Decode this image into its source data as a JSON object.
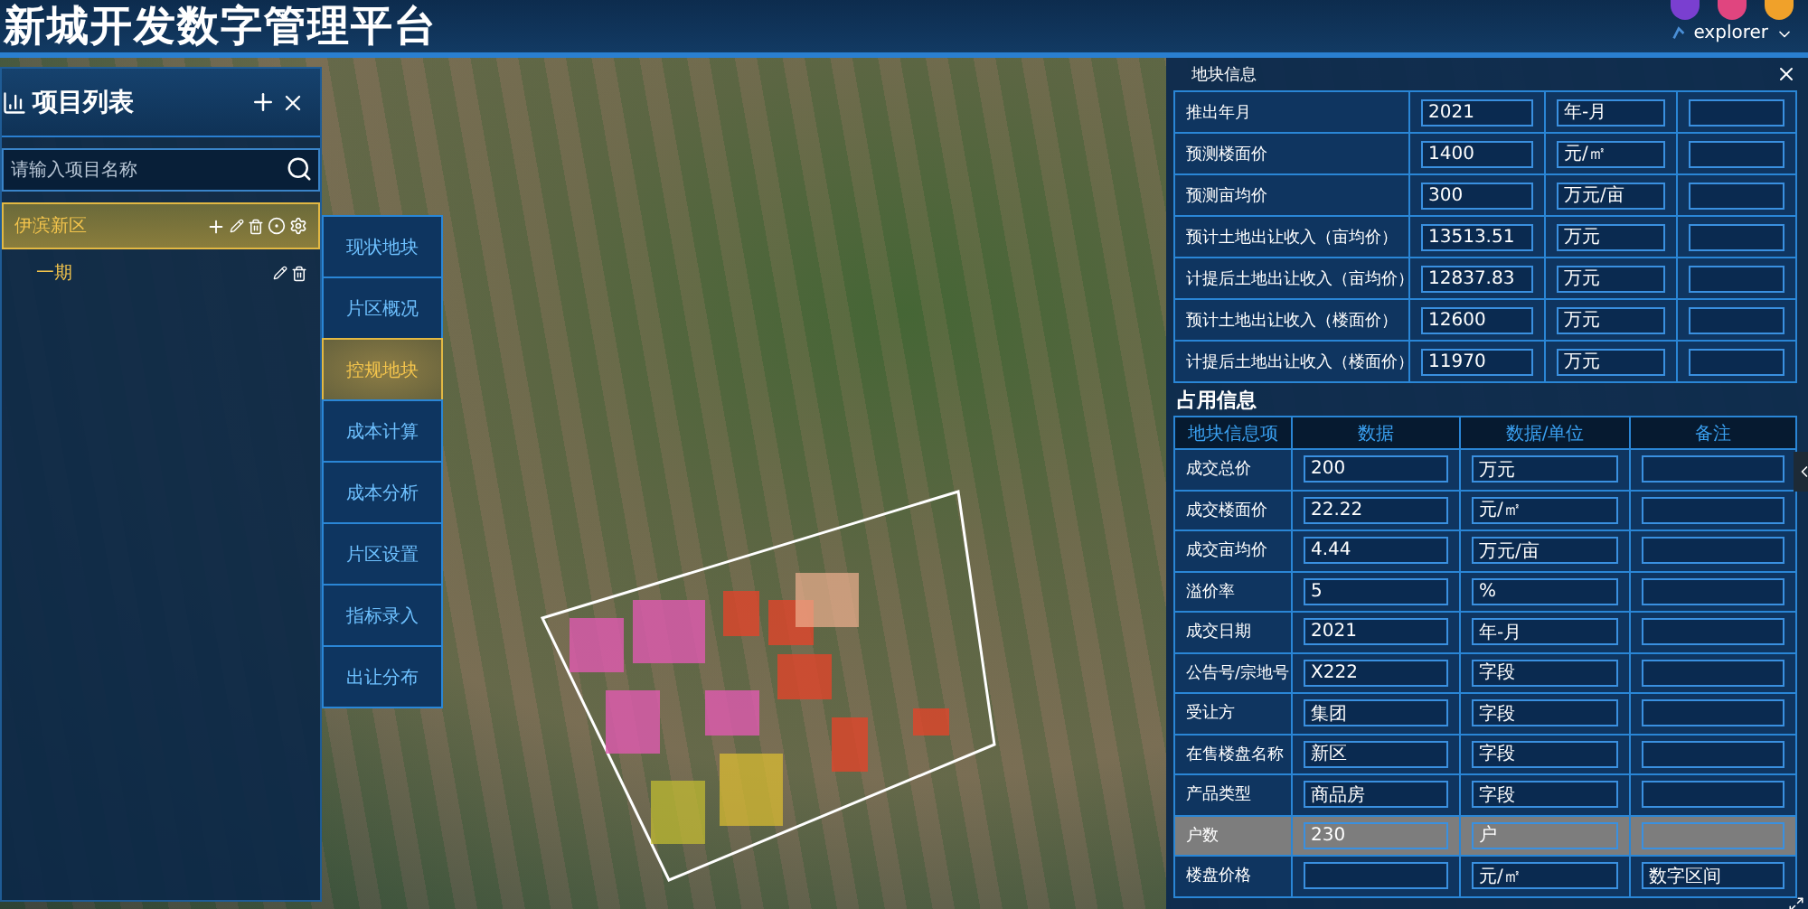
{
  "header": {
    "title": "新城开发数字管理平台",
    "user": "explorer"
  },
  "project_panel": {
    "title": "项目列表",
    "search": {
      "placeholder": "请输入项目名称"
    },
    "tree": [
      {
        "label": "伊滨新区",
        "selected": true,
        "children": [
          {
            "label": "一期",
            "selected": false
          }
        ]
      }
    ]
  },
  "side_tabs": [
    {
      "label": "现状地块",
      "selected": false
    },
    {
      "label": "片区概况",
      "selected": false
    },
    {
      "label": "控规地块",
      "selected": true
    },
    {
      "label": "成本计算",
      "selected": false
    },
    {
      "label": "成本分析",
      "selected": false
    },
    {
      "label": "片区设置",
      "selected": false
    },
    {
      "label": "指标录入",
      "selected": false
    },
    {
      "label": "出让分布",
      "selected": false
    }
  ],
  "parcel_panel": {
    "title": "地块信息",
    "rows": [
      {
        "label": "推出年月",
        "value": "2021",
        "unit": "年-月"
      },
      {
        "label": "预测楼面价",
        "value": "1400",
        "unit": "元/㎡"
      },
      {
        "label": "预测亩均价",
        "value": "300",
        "unit": "万元/亩"
      },
      {
        "label": "预计土地出让收入（亩均价）",
        "value": "13513.51",
        "unit": "万元"
      },
      {
        "label": "计提后土地出让收入（亩均价）",
        "value": "12837.83",
        "unit": "万元"
      },
      {
        "label": "预计土地出让收入（楼面价）",
        "value": "12600",
        "unit": "万元"
      },
      {
        "label": "计提后土地出让收入（楼面价）",
        "value": "11970",
        "unit": "万元"
      }
    ],
    "occupancy": {
      "title": "占用信息",
      "columns": [
        "地块信息项",
        "数据",
        "数据/单位",
        "备注"
      ],
      "rows": [
        {
          "label": "成交总价",
          "value": "200",
          "unit": "万元",
          "note": "",
          "selected": false
        },
        {
          "label": "成交楼面价",
          "value": "22.22",
          "unit": "元/㎡",
          "note": "",
          "selected": false
        },
        {
          "label": "成交亩均价",
          "value": "4.44",
          "unit": "万元/亩",
          "note": "",
          "selected": false
        },
        {
          "label": "溢价率",
          "value": "5",
          "unit": "%",
          "note": "",
          "selected": false
        },
        {
          "label": "成交日期",
          "value": "2021",
          "unit": "年-月",
          "note": "",
          "selected": false
        },
        {
          "label": "公告号/宗地号",
          "value": "X222",
          "unit": "字段",
          "note": "",
          "selected": false
        },
        {
          "label": "受让方",
          "value": "集团",
          "unit": "字段",
          "note": "",
          "selected": false
        },
        {
          "label": "在售楼盘名称",
          "value": "新区",
          "unit": "字段",
          "note": "",
          "selected": false
        },
        {
          "label": "产品类型",
          "value": "商品房",
          "unit": "字段",
          "note": "",
          "selected": false
        },
        {
          "label": "户数",
          "value": "230",
          "unit": "户",
          "note": "",
          "selected": true
        },
        {
          "label": "楼盘价格",
          "value": "",
          "unit": "元/㎡",
          "note": "数字区间",
          "selected": false
        }
      ]
    }
  }
}
